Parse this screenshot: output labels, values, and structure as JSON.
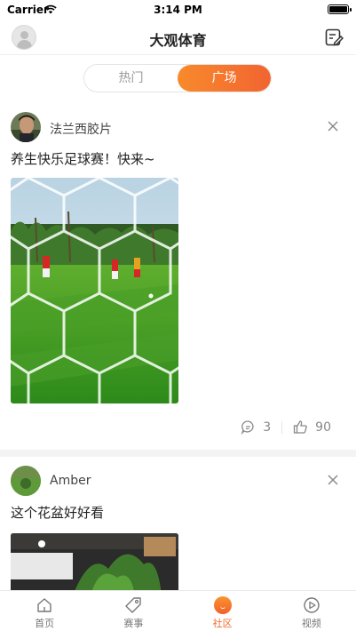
{
  "status": {
    "carrier": "Carrier",
    "time": "3:14 PM",
    "battery_level": 1.0
  },
  "nav": {
    "title": "大观体育"
  },
  "segment": {
    "tabs": [
      "热门",
      "广场"
    ],
    "active_index": 1
  },
  "posts": [
    {
      "username": "法兰西胶片",
      "text": "养生快乐足球赛！快来~",
      "image": "soccer-field-through-goal-net",
      "comments": "3",
      "likes": "90"
    },
    {
      "username": "Amber",
      "text": "这个花盆好好看",
      "image": "potted-plant"
    }
  ],
  "tabbar": {
    "items": [
      {
        "label": "首页",
        "icon": "home-icon"
      },
      {
        "label": "赛事",
        "icon": "tag-icon"
      },
      {
        "label": "社区",
        "icon": "community-icon"
      },
      {
        "label": "视频",
        "icon": "play-icon"
      }
    ],
    "active_index": 2
  },
  "colors": {
    "accent": "#f26a2c",
    "accent_light": "#f88a2c"
  }
}
